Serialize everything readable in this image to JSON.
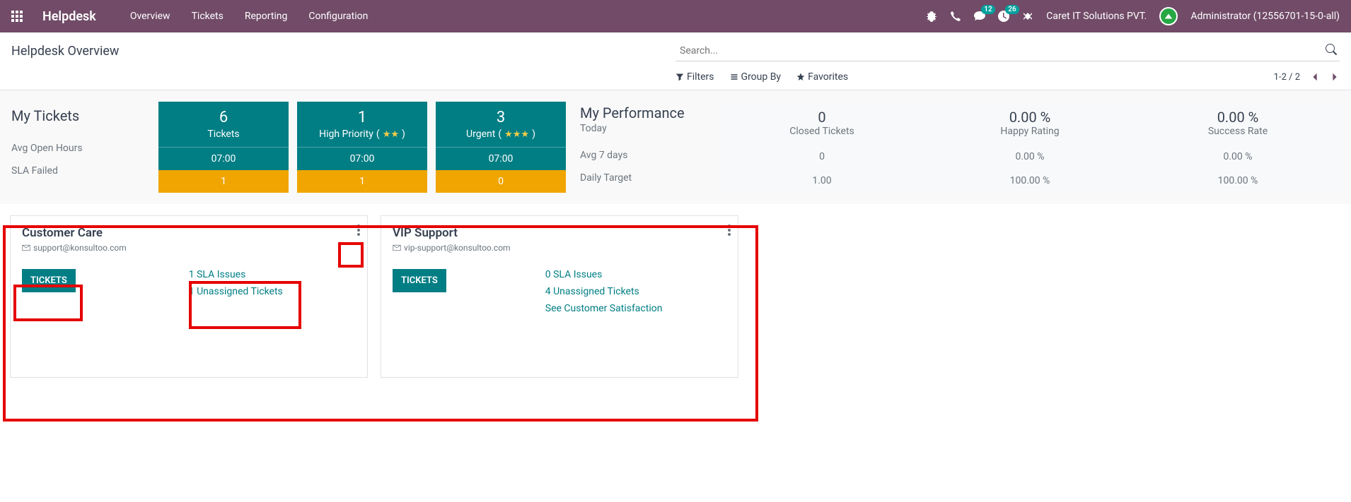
{
  "navbar": {
    "brand": "Helpdesk",
    "links": [
      "Overview",
      "Tickets",
      "Reporting",
      "Configuration"
    ],
    "messages_badge": "12",
    "activities_badge": "26",
    "company": "Caret IT Solutions PVT.",
    "user": "Administrator (12556701-15-0-all)"
  },
  "control_panel": {
    "title": "Helpdesk Overview",
    "search_placeholder": "Search...",
    "filters_label": "Filters",
    "groupby_label": "Group By",
    "favorites_label": "Favorites",
    "pager": "1-2 / 2"
  },
  "my_tickets": {
    "title": "My Tickets",
    "row_labels": [
      "Avg Open Hours",
      "SLA Failed"
    ],
    "blocks": [
      {
        "big": "6",
        "sub": "Tickets",
        "stars": 0,
        "mid": "07:00",
        "bot": "1"
      },
      {
        "big": "1",
        "sub": "High Priority",
        "stars": 2,
        "mid": "07:00",
        "bot": "1"
      },
      {
        "big": "3",
        "sub": "Urgent",
        "stars": 3,
        "mid": "07:00",
        "bot": "0"
      }
    ]
  },
  "performance": {
    "title": "My Performance",
    "today_label": "Today",
    "row_labels": [
      "Avg 7 days",
      "Daily Target"
    ],
    "cols": [
      {
        "big": "0",
        "label": "Closed Tickets",
        "avg": "0",
        "target": "1.00"
      },
      {
        "big": "0.00 %",
        "label": "Happy Rating",
        "avg": "0.00 %",
        "target": "100.00 %"
      },
      {
        "big": "0.00 %",
        "label": "Success Rate",
        "avg": "0.00 %",
        "target": "100.00 %"
      }
    ]
  },
  "cards": [
    {
      "title": "Customer Care",
      "email": "support@konsultoo.com",
      "button": "TICKETS",
      "links": [
        "1 SLA Issues",
        "1 Unassigned Tickets"
      ]
    },
    {
      "title": "VIP Support",
      "email": "vip-support@konsultoo.com",
      "button": "TICKETS",
      "links": [
        "0 SLA Issues",
        "4 Unassigned Tickets",
        "See Customer Satisfaction"
      ]
    }
  ]
}
